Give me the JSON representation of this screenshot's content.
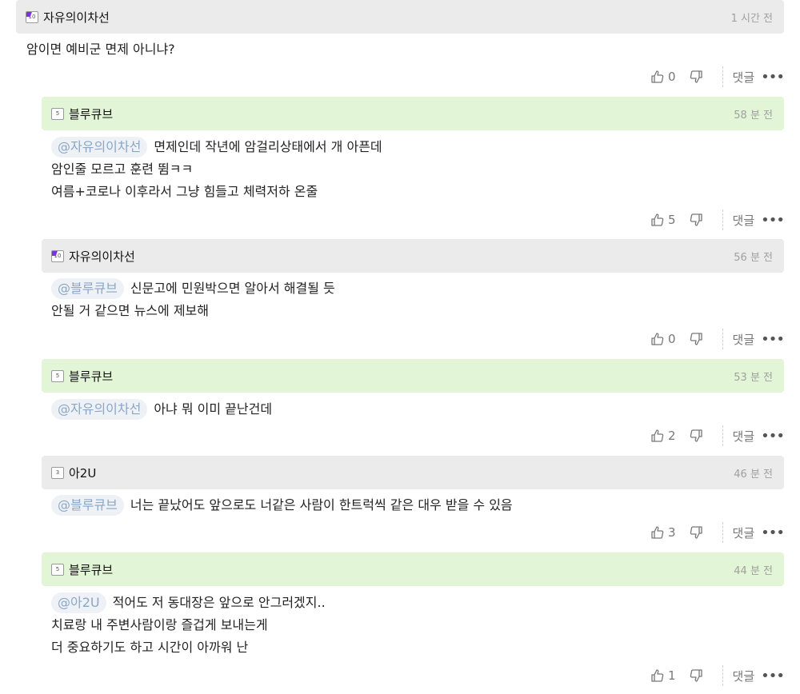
{
  "comments": [
    {
      "nick": "자유의이차선",
      "time": "1 시간 전",
      "mention": "",
      "lines": [
        "암이면 예비군 면제 아니냐?",
        "",
        ""
      ],
      "likes": "0",
      "reply_label": "댓글",
      "badge": "purple-10",
      "header_style": "gray"
    },
    {
      "nick": "블루큐브",
      "time": "58 분 전",
      "mention": "@자유의이차선",
      "lines": [
        "면제인데 작년에 암걸리상태에서 개 아픈데",
        "암인줄 모르고 훈련 뜀ㅋㅋ",
        "여름+코로나 이후라서 그냥 힘들고 체력저하 온줄"
      ],
      "likes": "5",
      "reply_label": "댓글",
      "badge": "5",
      "header_style": "green"
    },
    {
      "nick": "자유의이차선",
      "time": "56 분 전",
      "mention": "@블루큐브",
      "lines": [
        "신문고에 민원박으면 알아서 해결될 듯",
        "안될 거 같으면 뉴스에 제보해",
        ""
      ],
      "likes": "0",
      "reply_label": "댓글",
      "badge": "purple-10",
      "header_style": "gray"
    },
    {
      "nick": "블루큐브",
      "time": "53 분 전",
      "mention": "@자유의이차선",
      "lines": [
        "아냐 뭐 이미 끝난건데",
        "",
        ""
      ],
      "likes": "2",
      "reply_label": "댓글",
      "badge": "5",
      "header_style": "green"
    },
    {
      "nick": "아2U",
      "time": "46 분 전",
      "mention": "@블루큐브",
      "lines": [
        "너는 끝났어도 앞으로도 너같은 사람이 한트럭씩 같은 대우 받을 수 있음",
        "",
        ""
      ],
      "likes": "3",
      "reply_label": "댓글",
      "badge": "3",
      "header_style": "gray"
    },
    {
      "nick": "블루큐브",
      "time": "44 분 전",
      "mention": "@아2U",
      "lines": [
        "적어도 저 동대장은 앞으로 안그러겠지..",
        "치료랑 내 주변사람이랑 즐겁게 보내는게",
        "더 중요하기도 하고 시간이 아까워 난"
      ],
      "likes": "1",
      "reply_label": "댓글",
      "badge": "5",
      "header_style": "green"
    }
  ],
  "icons": {
    "like": "thumbs-up-icon",
    "dislike": "thumbs-down-icon",
    "more": "more-dots-icon",
    "more_glyph": "•••"
  }
}
